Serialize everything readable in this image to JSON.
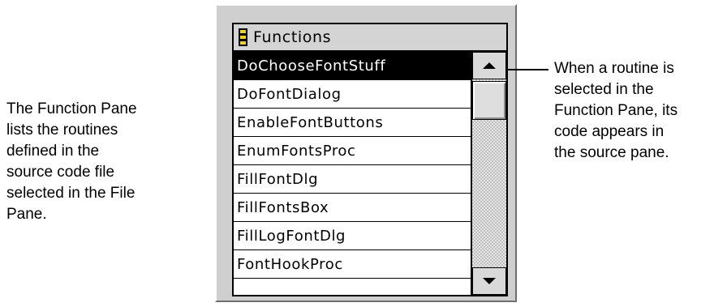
{
  "left_caption": {
    "lines": [
      "The Function Pane",
      "lists the routines",
      "defined in the",
      "source code file",
      "selected in the File",
      "Pane."
    ]
  },
  "right_caption": {
    "lines": [
      "When a routine is",
      "selected in the",
      "Function Pane, its",
      "code appears in",
      "the source pane."
    ]
  },
  "pane": {
    "title": "Functions",
    "items": [
      {
        "label": "DoChooseFontStuff",
        "selected": true
      },
      {
        "label": "DoFontDialog",
        "selected": false
      },
      {
        "label": "EnableFontButtons",
        "selected": false
      },
      {
        "label": "EnumFontsProc",
        "selected": false
      },
      {
        "label": "FillFontDlg",
        "selected": false
      },
      {
        "label": "FillFontsBox",
        "selected": false
      },
      {
        "label": "FillLogFontDlg",
        "selected": false
      },
      {
        "label": "FontHookProc",
        "selected": false
      }
    ],
    "header_icon": "pane-marker-icon",
    "scroll_up_icon": "scroll-up-arrow-icon",
    "scroll_down_icon": "scroll-down-arrow-icon"
  }
}
